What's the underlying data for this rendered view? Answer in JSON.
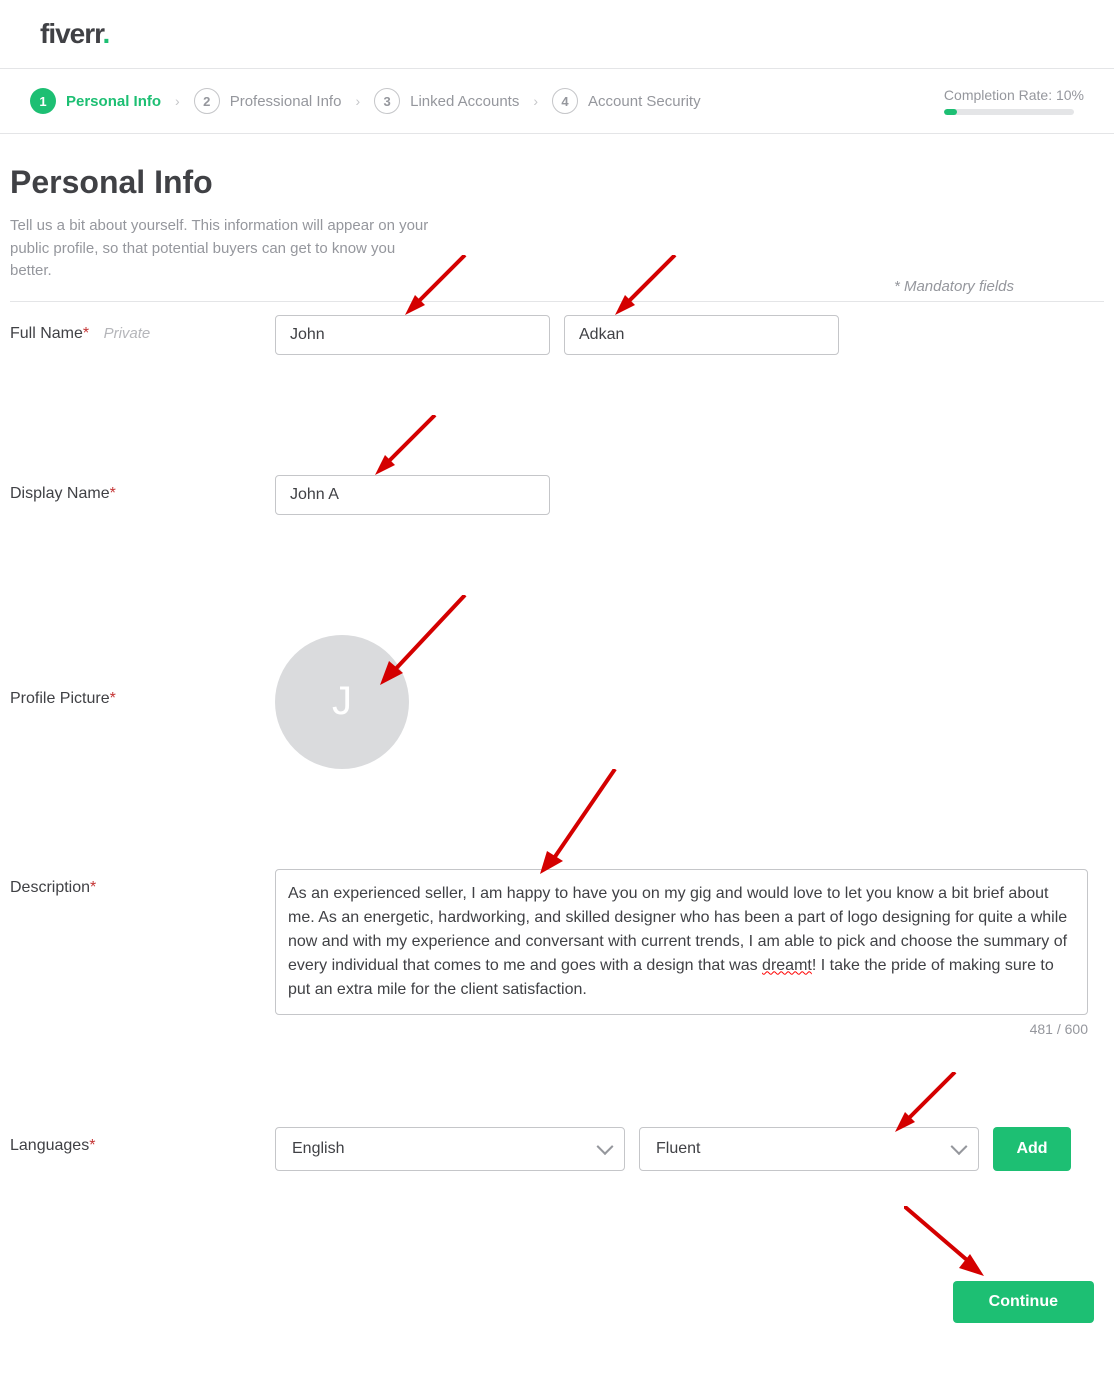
{
  "logo": {
    "text": "fiverr",
    "dot": "."
  },
  "steps": [
    {
      "num": "1",
      "label": "Personal Info",
      "active": true
    },
    {
      "num": "2",
      "label": "Professional Info",
      "active": false
    },
    {
      "num": "3",
      "label": "Linked Accounts",
      "active": false
    },
    {
      "num": "4",
      "label": "Account Security",
      "active": false
    }
  ],
  "completion": {
    "label": "Completion Rate: 10%",
    "percent": 10
  },
  "page": {
    "title": "Personal Info",
    "subtitle": "Tell us a bit about yourself. This information will appear on your public profile, so that potential buyers can get to know you better.",
    "mandatory_note": "* Mandatory fields"
  },
  "labels": {
    "full_name": "Full Name",
    "private": "Private",
    "display_name": "Display Name",
    "profile_picture": "Profile Picture",
    "description": "Description",
    "languages": "Languages"
  },
  "form": {
    "first_name": "John",
    "last_name": "Adkan",
    "display_name": "John A",
    "avatar_initial": "J",
    "description_text": "As an experienced seller, I am happy to have you on my gig and would love to let you know a bit brief about me. As an energetic, hardworking, and skilled designer who has been a part of logo designing for quite a while now and with my experience and conversant with current trends, I am able to pick and choose the summary of every individual that comes to me and goes with a design that was dreamt! I take the pride of making sure to put an extra mile for the client satisfaction.",
    "description_count": "481 / 600",
    "language": "English",
    "proficiency": "Fluent"
  },
  "buttons": {
    "add": "Add",
    "continue": "Continue"
  },
  "colors": {
    "accent": "#1dbf73",
    "required": "#c43333"
  }
}
